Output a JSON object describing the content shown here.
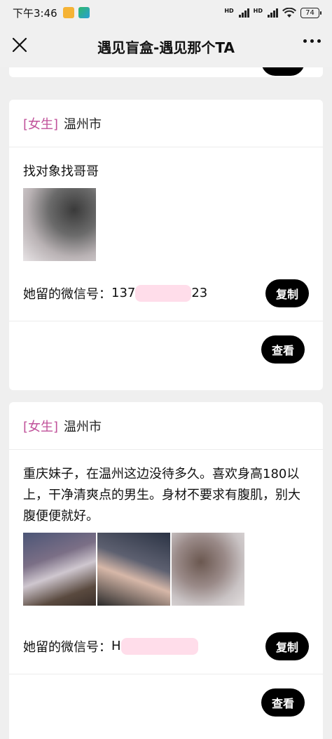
{
  "status_bar": {
    "time": "下午3:46",
    "battery": "74",
    "hd1": "HD",
    "hd2": "HD"
  },
  "nav": {
    "title": "遇见盲盒-遇见那个TA",
    "close_icon": "close-icon",
    "more_icon": "more-icon"
  },
  "cards": [
    {
      "gender": "[女生]",
      "city": "温州市",
      "description": "找对象找哥哥",
      "wechat_label": "她留的微信号：",
      "wechat_prefix": "137",
      "wechat_suffix": "23",
      "copy_label": "复制",
      "view_label": "查看"
    },
    {
      "gender": "[女生]",
      "city": "温州市",
      "description": "重庆妹子，在温州这边没待多久。喜欢身高180以上，干净清爽点的男生。身材不要求有腹肌，别大腹便便就好。",
      "wechat_label": "她留的微信号：",
      "wechat_prefix": "H",
      "wechat_suffix": "",
      "copy_label": "复制",
      "view_label": "查看"
    }
  ],
  "colors": {
    "gender_tag": "#c0519a",
    "button_bg": "#000000",
    "page_bg": "#efefef"
  }
}
